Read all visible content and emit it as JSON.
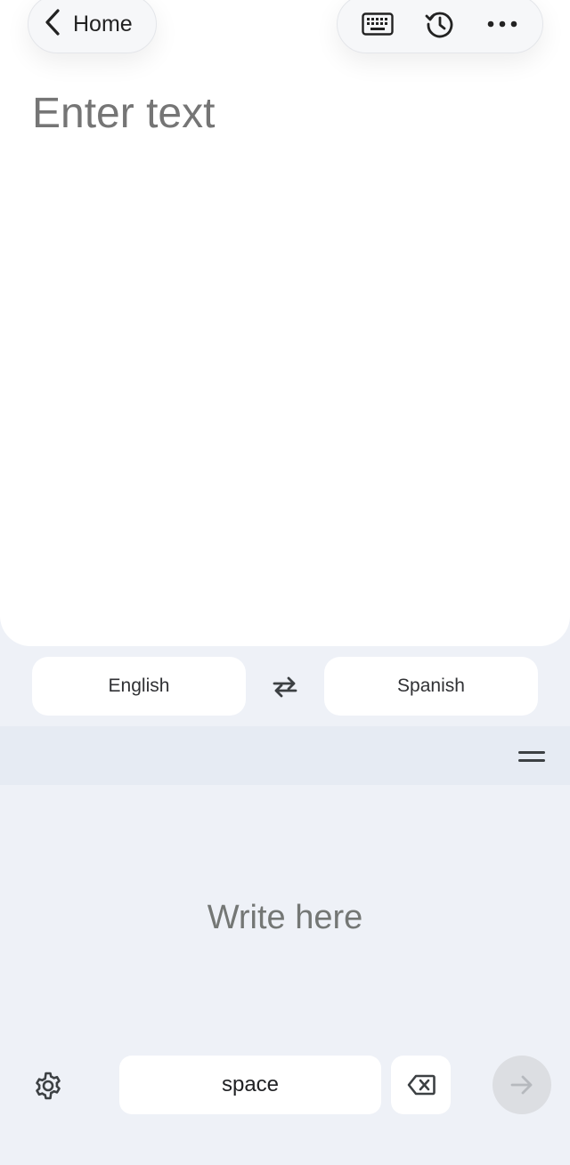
{
  "header": {
    "home_label": "Home",
    "icons": [
      "chevron-left-icon",
      "keyboard-icon",
      "history-icon",
      "more-horizontal-icon"
    ]
  },
  "source": {
    "placeholder": "Enter text"
  },
  "languages": {
    "source": "English",
    "target": "Spanish",
    "swap_icon": "swap-arrows-icon"
  },
  "handwriting": {
    "placeholder": "Write here",
    "space_label": "space",
    "icons": [
      "drag-handle-icon",
      "settings-gear-icon",
      "backspace-icon",
      "arrow-right-icon"
    ]
  },
  "colors": {
    "background": "#eef1f7",
    "card": "#ffffff",
    "panel_header": "#e6ebf3",
    "placeholder_text": "#787878",
    "disabled_enter": "#dcdee2"
  }
}
